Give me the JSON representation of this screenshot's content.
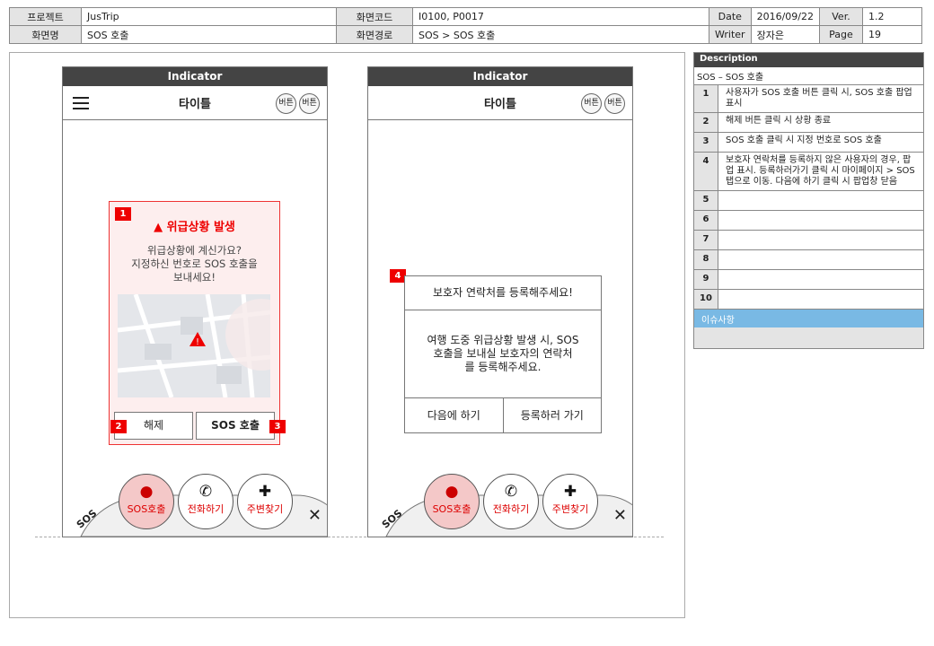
{
  "header": {
    "project_label": "프로젝트",
    "project": "JusTrip",
    "screen_code_label": "화면코드",
    "screen_code": "I0100, P0017",
    "date_label": "Date",
    "date": "2016/09/22",
    "ver_label": "Ver.",
    "ver": "1.2",
    "screen_name_label": "화면명",
    "screen_name": "SOS 호출",
    "screen_path_label": "화면경로",
    "screen_path": "SOS > SOS 호출",
    "writer_label": "Writer",
    "writer": "장자은",
    "page_label": "Page",
    "page": "19"
  },
  "phone_common": {
    "indicator": "Indicator",
    "title": "타이틀",
    "round_btn": "버튼",
    "sos_tab": "SOS",
    "sos_call": "SOS호출",
    "phone_call": "전화하기",
    "nearby": "주변찾기",
    "close": "✕"
  },
  "screen1": {
    "popup_title": "위급상황 발생",
    "popup_body": "위급상황에 계신가요?\n지정하신 번호로 SOS 호출을\n보내세요!",
    "cancel": "해제",
    "call": "SOS 호출",
    "badge1": "1",
    "badge2": "2",
    "badge3": "3"
  },
  "screen2": {
    "popup_title": "보호자 연락처를 등록해주세요!",
    "popup_body": "여행 도중 위급상황 발생 시, SOS\n호출을 보내실 보호자의 연락처\n를 등록해주세요.",
    "later": "다음에 하기",
    "register": "등록하러 가기",
    "badge4": "4"
  },
  "description": {
    "title": "Description",
    "subtitle": "SOS – SOS 호출",
    "items": [
      {
        "n": "1",
        "text": "사용자가 SOS 호출 버튼 클릭 시, SOS 호출 팝업 표시"
      },
      {
        "n": "2",
        "text": "해제 버튼 클릭 시 상황 종료"
      },
      {
        "n": "3",
        "text": "SOS 호출 클릭 시 지정 번호로 SOS 호출"
      },
      {
        "n": "4",
        "text": "보호자 연락처를 등록하지 않은 사용자의 경우, 팝업 표시. 등록하러가기 클릭 시 마이페이지 > SOS 탭으로 이동. 다음에 하기 클릭 시 팝업창 닫음"
      },
      {
        "n": "5",
        "text": ""
      },
      {
        "n": "6",
        "text": ""
      },
      {
        "n": "7",
        "text": ""
      },
      {
        "n": "8",
        "text": ""
      },
      {
        "n": "9",
        "text": ""
      },
      {
        "n": "10",
        "text": ""
      }
    ],
    "issues_label": "이슈사항"
  },
  "colors": {
    "accent_red": "#e00000",
    "issue_blue": "#79b9e4",
    "header_gray": "#e4e4e4"
  }
}
